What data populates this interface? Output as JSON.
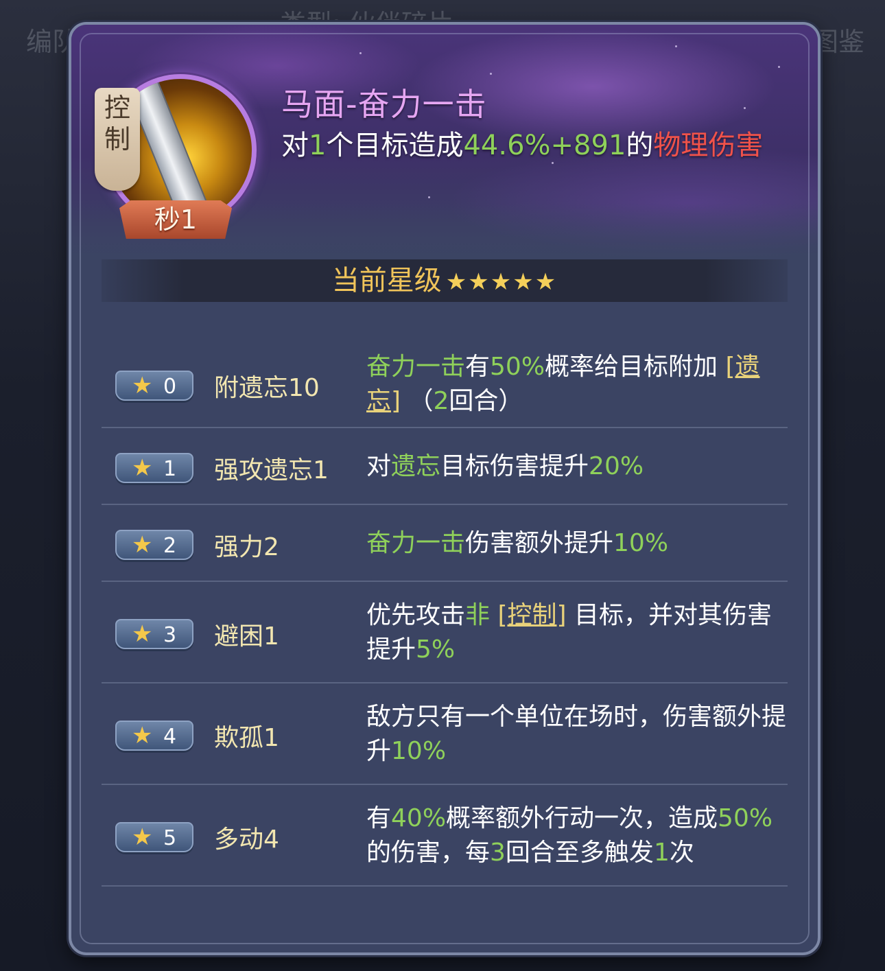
{
  "background": {
    "left_text": "编队",
    "top_text": "类型: 伙伴碎片",
    "right_text": "图鉴"
  },
  "skill": {
    "tag": "控制",
    "cooldown": "秒1",
    "name": "马面-奋力一击",
    "desc": {
      "p1": "对",
      "count": "1",
      "p2": "个目标造成",
      "value": "44.6%+891",
      "p3": "的",
      "dmg_type": "物理伤害"
    }
  },
  "star_section": {
    "label": "当前星级",
    "stars": "★★★★★"
  },
  "traits": [
    {
      "level": "0",
      "name": "附遗忘10",
      "desc": [
        {
          "t": "奋力一击",
          "c": "g"
        },
        {
          "t": "有",
          "c": ""
        },
        {
          "t": "50%",
          "c": "g"
        },
        {
          "t": "概率给目标附加 ",
          "c": ""
        },
        {
          "t": "[遗忘]",
          "c": "y"
        },
        {
          "t": " （",
          "c": ""
        },
        {
          "t": "2",
          "c": "g"
        },
        {
          "t": "回合）",
          "c": ""
        }
      ]
    },
    {
      "level": "1",
      "name": "强攻遗忘1",
      "desc": [
        {
          "t": "对",
          "c": ""
        },
        {
          "t": "遗忘",
          "c": "g"
        },
        {
          "t": "目标伤害提升",
          "c": ""
        },
        {
          "t": "20%",
          "c": "g"
        }
      ]
    },
    {
      "level": "2",
      "name": "强力2",
      "desc": [
        {
          "t": "奋力一击",
          "c": "g"
        },
        {
          "t": "伤害额外提升",
          "c": ""
        },
        {
          "t": "10%",
          "c": "g"
        }
      ]
    },
    {
      "level": "3",
      "name": "避困1",
      "desc": [
        {
          "t": "优先攻击",
          "c": ""
        },
        {
          "t": "非 ",
          "c": "g"
        },
        {
          "t": "[控制]",
          "c": "y"
        },
        {
          "t": " 目标，并对其伤害提升",
          "c": ""
        },
        {
          "t": "5%",
          "c": "g"
        }
      ]
    },
    {
      "level": "4",
      "name": "欺孤1",
      "desc": [
        {
          "t": "敌方只有一个单位在场时，伤害额外提升",
          "c": ""
        },
        {
          "t": "10%",
          "c": "g"
        }
      ]
    },
    {
      "level": "5",
      "name": "多动4",
      "desc": [
        {
          "t": "有",
          "c": ""
        },
        {
          "t": "40%",
          "c": "g"
        },
        {
          "t": "概率额外行动一次，造成",
          "c": ""
        },
        {
          "t": "50%",
          "c": "g"
        },
        {
          "t": "的伤害，每",
          "c": ""
        },
        {
          "t": "3",
          "c": "g"
        },
        {
          "t": "回合至多触发",
          "c": ""
        },
        {
          "t": "1",
          "c": "g"
        },
        {
          "t": "次",
          "c": ""
        }
      ]
    }
  ],
  "colors": {
    "highlight_green": "#8fd15a",
    "damage_red": "#f0524a",
    "keyword_yellow": "#e9d27a",
    "skill_name_pink": "#e6a6f2"
  },
  "icons": [
    "star-icon",
    "sword-skill-icon"
  ]
}
